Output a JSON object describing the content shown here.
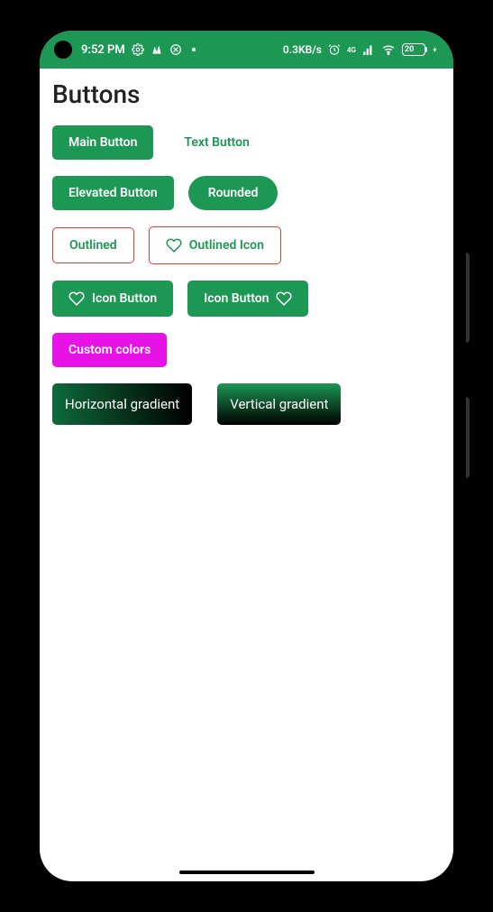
{
  "status": {
    "time": "9:52 PM",
    "network_speed": "0.3KB/s",
    "cellular_label": "4G",
    "battery_text": "20"
  },
  "page": {
    "title": "Buttons"
  },
  "buttons": {
    "main": "Main Button",
    "text": "Text Button",
    "elevated": "Elevated Button",
    "rounded": "Rounded",
    "outlined": "Outlined",
    "outlined_icon": "Outlined Icon",
    "icon_leading": "Icon Button",
    "icon_trailing": "Icon Button",
    "custom_colors": "Custom colors",
    "h_gradient": "Horizontal gradient",
    "v_gradient": "Vertical gradient"
  },
  "colors": {
    "primary": "#1c9754",
    "outline": "#e53935",
    "custom_bg": "#e612e6"
  }
}
